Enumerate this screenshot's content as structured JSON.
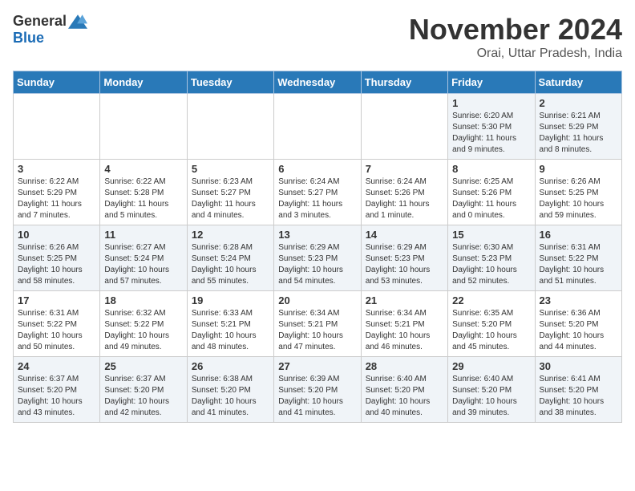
{
  "logo": {
    "general": "General",
    "blue": "Blue"
  },
  "title": "November 2024",
  "subtitle": "Orai, Uttar Pradesh, India",
  "headers": [
    "Sunday",
    "Monday",
    "Tuesday",
    "Wednesday",
    "Thursday",
    "Friday",
    "Saturday"
  ],
  "weeks": [
    [
      {
        "num": "",
        "info": ""
      },
      {
        "num": "",
        "info": ""
      },
      {
        "num": "",
        "info": ""
      },
      {
        "num": "",
        "info": ""
      },
      {
        "num": "",
        "info": ""
      },
      {
        "num": "1",
        "info": "Sunrise: 6:20 AM\nSunset: 5:30 PM\nDaylight: 11 hours and 9 minutes."
      },
      {
        "num": "2",
        "info": "Sunrise: 6:21 AM\nSunset: 5:29 PM\nDaylight: 11 hours and 8 minutes."
      }
    ],
    [
      {
        "num": "3",
        "info": "Sunrise: 6:22 AM\nSunset: 5:29 PM\nDaylight: 11 hours and 7 minutes."
      },
      {
        "num": "4",
        "info": "Sunrise: 6:22 AM\nSunset: 5:28 PM\nDaylight: 11 hours and 5 minutes."
      },
      {
        "num": "5",
        "info": "Sunrise: 6:23 AM\nSunset: 5:27 PM\nDaylight: 11 hours and 4 minutes."
      },
      {
        "num": "6",
        "info": "Sunrise: 6:24 AM\nSunset: 5:27 PM\nDaylight: 11 hours and 3 minutes."
      },
      {
        "num": "7",
        "info": "Sunrise: 6:24 AM\nSunset: 5:26 PM\nDaylight: 11 hours and 1 minute."
      },
      {
        "num": "8",
        "info": "Sunrise: 6:25 AM\nSunset: 5:26 PM\nDaylight: 11 hours and 0 minutes."
      },
      {
        "num": "9",
        "info": "Sunrise: 6:26 AM\nSunset: 5:25 PM\nDaylight: 10 hours and 59 minutes."
      }
    ],
    [
      {
        "num": "10",
        "info": "Sunrise: 6:26 AM\nSunset: 5:25 PM\nDaylight: 10 hours and 58 minutes."
      },
      {
        "num": "11",
        "info": "Sunrise: 6:27 AM\nSunset: 5:24 PM\nDaylight: 10 hours and 57 minutes."
      },
      {
        "num": "12",
        "info": "Sunrise: 6:28 AM\nSunset: 5:24 PM\nDaylight: 10 hours and 55 minutes."
      },
      {
        "num": "13",
        "info": "Sunrise: 6:29 AM\nSunset: 5:23 PM\nDaylight: 10 hours and 54 minutes."
      },
      {
        "num": "14",
        "info": "Sunrise: 6:29 AM\nSunset: 5:23 PM\nDaylight: 10 hours and 53 minutes."
      },
      {
        "num": "15",
        "info": "Sunrise: 6:30 AM\nSunset: 5:23 PM\nDaylight: 10 hours and 52 minutes."
      },
      {
        "num": "16",
        "info": "Sunrise: 6:31 AM\nSunset: 5:22 PM\nDaylight: 10 hours and 51 minutes."
      }
    ],
    [
      {
        "num": "17",
        "info": "Sunrise: 6:31 AM\nSunset: 5:22 PM\nDaylight: 10 hours and 50 minutes."
      },
      {
        "num": "18",
        "info": "Sunrise: 6:32 AM\nSunset: 5:22 PM\nDaylight: 10 hours and 49 minutes."
      },
      {
        "num": "19",
        "info": "Sunrise: 6:33 AM\nSunset: 5:21 PM\nDaylight: 10 hours and 48 minutes."
      },
      {
        "num": "20",
        "info": "Sunrise: 6:34 AM\nSunset: 5:21 PM\nDaylight: 10 hours and 47 minutes."
      },
      {
        "num": "21",
        "info": "Sunrise: 6:34 AM\nSunset: 5:21 PM\nDaylight: 10 hours and 46 minutes."
      },
      {
        "num": "22",
        "info": "Sunrise: 6:35 AM\nSunset: 5:20 PM\nDaylight: 10 hours and 45 minutes."
      },
      {
        "num": "23",
        "info": "Sunrise: 6:36 AM\nSunset: 5:20 PM\nDaylight: 10 hours and 44 minutes."
      }
    ],
    [
      {
        "num": "24",
        "info": "Sunrise: 6:37 AM\nSunset: 5:20 PM\nDaylight: 10 hours and 43 minutes."
      },
      {
        "num": "25",
        "info": "Sunrise: 6:37 AM\nSunset: 5:20 PM\nDaylight: 10 hours and 42 minutes."
      },
      {
        "num": "26",
        "info": "Sunrise: 6:38 AM\nSunset: 5:20 PM\nDaylight: 10 hours and 41 minutes."
      },
      {
        "num": "27",
        "info": "Sunrise: 6:39 AM\nSunset: 5:20 PM\nDaylight: 10 hours and 41 minutes."
      },
      {
        "num": "28",
        "info": "Sunrise: 6:40 AM\nSunset: 5:20 PM\nDaylight: 10 hours and 40 minutes."
      },
      {
        "num": "29",
        "info": "Sunrise: 6:40 AM\nSunset: 5:20 PM\nDaylight: 10 hours and 39 minutes."
      },
      {
        "num": "30",
        "info": "Sunrise: 6:41 AM\nSunset: 5:20 PM\nDaylight: 10 hours and 38 minutes."
      }
    ]
  ]
}
